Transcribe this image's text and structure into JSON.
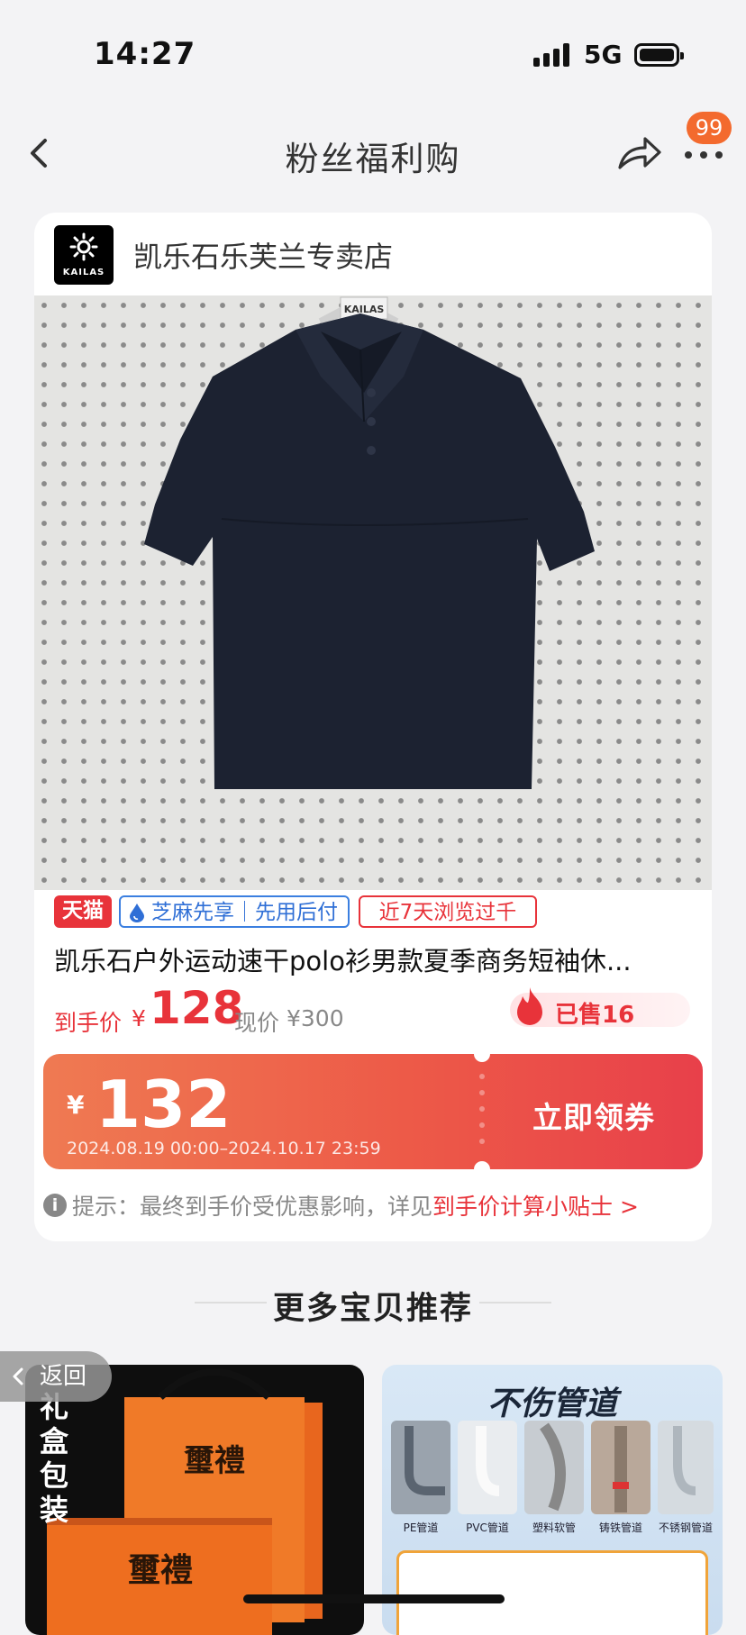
{
  "status_bar": {
    "time": "14:27",
    "network": "5G"
  },
  "nav": {
    "title": "粉丝福利购",
    "badge_count": "99"
  },
  "store": {
    "logo_text": "KAILAS",
    "name": "凯乐石乐芙兰专卖店"
  },
  "product": {
    "photo_label": "KAILAS",
    "tags": {
      "tmall": "天猫",
      "zhima": "芝麻先享｜先用后付",
      "views": "近7天浏览过千"
    },
    "title": "凯乐石户外运动速干polo衫男款夏季商务短袖休...",
    "price_label": "到手价",
    "price_currency": "¥",
    "price_value": "128",
    "orig_label": "现价",
    "orig_value": "¥300",
    "sold": "已售16"
  },
  "coupon": {
    "currency": "¥",
    "amount": "132",
    "validity": "2024.08.19 00:00–2024.10.17 23:59",
    "button": "立即领券"
  },
  "tip": {
    "icon": "i",
    "prefix": "提示：最终到手价受优惠影响，详见",
    "link": "到手价计算小贴士 >"
  },
  "recommend": {
    "title": "更多宝贝推荐",
    "left": {
      "vertical_text": "礼盒包装",
      "brand": "璽禮"
    },
    "right": {
      "headline": "不伤管道",
      "pipes": [
        "PE管道",
        "PVC管道",
        "塑料软管",
        "铸铁管道",
        "不锈钢管道"
      ]
    }
  },
  "float_back": {
    "label": "返回"
  },
  "colors": {
    "accent": "#e8333a",
    "badge": "#f36a2e"
  }
}
